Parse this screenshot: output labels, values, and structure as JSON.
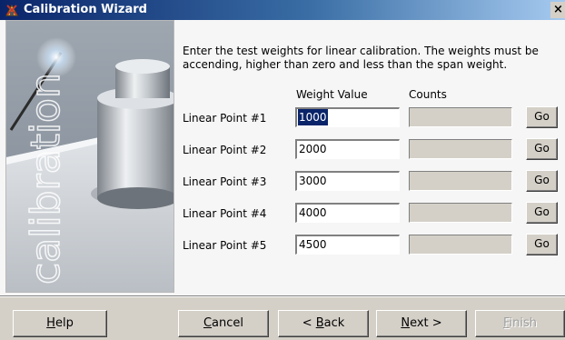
{
  "window": {
    "title": "Calibration Wizard",
    "close_glyph": "×",
    "icon": "calibration-wizard-app-icon"
  },
  "side_panel": {
    "watermark_text": "calibration",
    "image": "calibration weight on scale platform"
  },
  "instructions": "Enter the test weights for linear calibration. The weights must be accending, higher than zero and less than the span weight.",
  "columns": {
    "weight_header": "Weight Value",
    "counts_header": "Counts"
  },
  "rows": [
    {
      "label": "Linear Point #1",
      "weight": "1000",
      "counts": "",
      "go": "Go",
      "selected": true
    },
    {
      "label": "Linear Point #2",
      "weight": "2000",
      "counts": "",
      "go": "Go",
      "selected": false
    },
    {
      "label": "Linear Point #3",
      "weight": "3000",
      "counts": "",
      "go": "Go",
      "selected": false
    },
    {
      "label": "Linear Point #4",
      "weight": "4000",
      "counts": "",
      "go": "Go",
      "selected": false
    },
    {
      "label": "Linear Point #5",
      "weight": "4500",
      "counts": "",
      "go": "Go",
      "selected": false
    }
  ],
  "footer": {
    "help": {
      "pre": "",
      "u": "H",
      "post": "elp"
    },
    "cancel": {
      "pre": "",
      "u": "C",
      "post": "ancel"
    },
    "back": {
      "pre": "< ",
      "u": "B",
      "post": "ack"
    },
    "next": {
      "pre": "",
      "u": "N",
      "post": "ext >"
    },
    "finish": {
      "pre": "",
      "u": "F",
      "post": "inish",
      "enabled": false
    }
  },
  "colors": {
    "title_gradient_start": "#0a246a",
    "title_gradient_end": "#a6caf0",
    "dialog_face": "#d4d0c8",
    "content_bg": "#f6f6f6",
    "selection": "#0a246a"
  }
}
